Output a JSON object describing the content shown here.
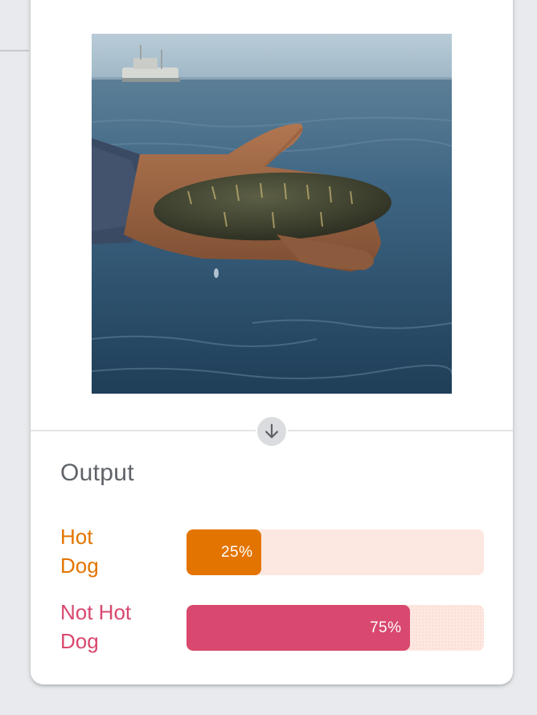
{
  "output": {
    "title": "Output"
  },
  "predictions": [
    {
      "label": "Hot\nDog",
      "percent_text": "25%",
      "value": 0.25,
      "color": "#e37400",
      "track_color": "#fde8e1"
    },
    {
      "label": "Not Hot\nDog",
      "percent_text": "75%",
      "value": 0.75,
      "color": "#d9486e",
      "track_color": "#fde8e1"
    }
  ],
  "icons": {
    "process_arrow": "arrow-down-icon"
  }
}
